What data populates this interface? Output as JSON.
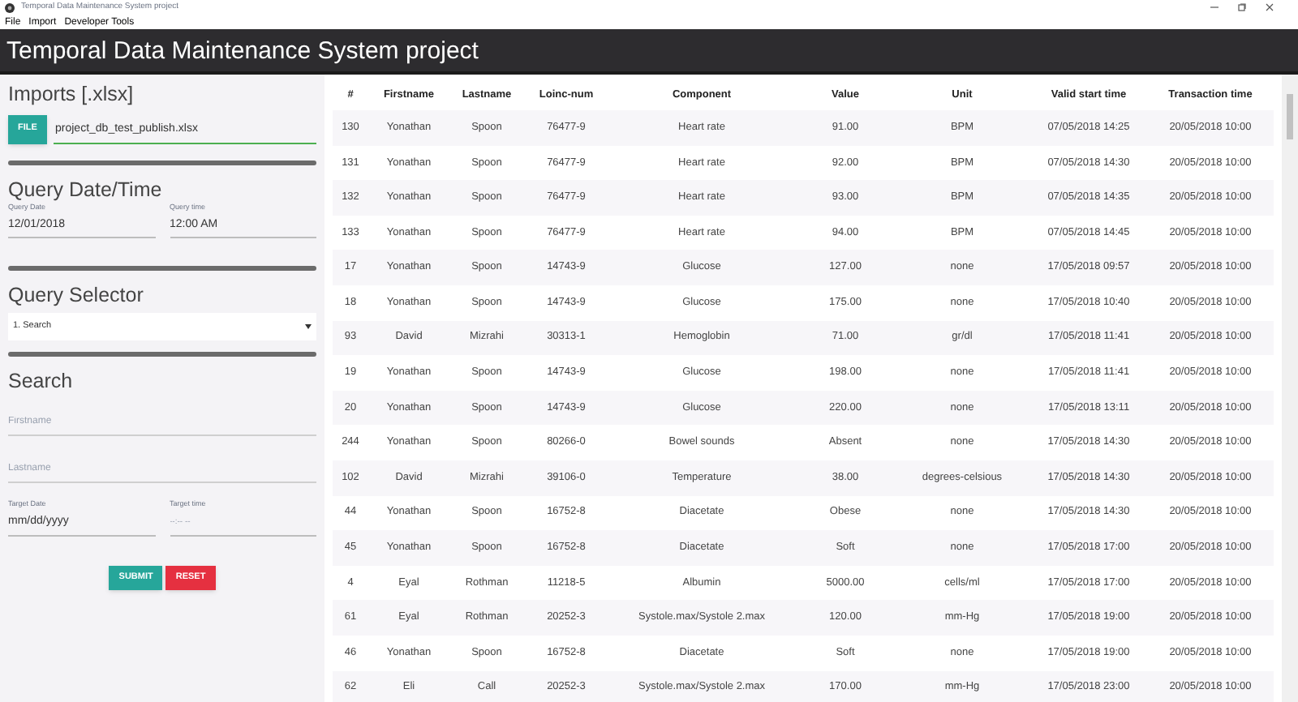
{
  "window": {
    "title": "Temporal Data Maintenance System project"
  },
  "menu": [
    "File",
    "Import",
    "Developer Tools"
  ],
  "header": {
    "title": "Temporal Data Maintenance System project"
  },
  "imports": {
    "title": "Imports [.xlsx]",
    "button": "FILE",
    "value": "project_db_test_publish.xlsx"
  },
  "query_datetime": {
    "title": "Query Date/Time",
    "fields": [
      {
        "label": "Query Date",
        "value": "12/01/2018"
      },
      {
        "label": "Query time",
        "value": "12:00 AM"
      }
    ]
  },
  "query_selector": {
    "title": "Query Selector",
    "value": "1. Search"
  },
  "search": {
    "title": "Search",
    "fields": [
      {
        "placeholder": "Firstname"
      },
      {
        "placeholder": "Lastname"
      }
    ],
    "targets": [
      {
        "label": "Target Date",
        "placeholder": "mm/dd/yyyy"
      },
      {
        "label": "Target time",
        "placeholder": "--:-- --"
      }
    ],
    "buttons": [
      {
        "label": "SUBMIT",
        "kind": "submit"
      },
      {
        "label": "RESET",
        "kind": "reset"
      }
    ]
  },
  "table": {
    "columns": [
      "#",
      "Firstname",
      "Lastname",
      "Loinc-num",
      "Component",
      "Value",
      "Unit",
      "Valid start time",
      "Transaction time"
    ],
    "rows": [
      [
        "130",
        "Yonathan",
        "Spoon",
        "76477-9",
        "Heart rate",
        "91.00",
        "BPM",
        "07/05/2018 14:25",
        "20/05/2018 10:00"
      ],
      [
        "131",
        "Yonathan",
        "Spoon",
        "76477-9",
        "Heart rate",
        "92.00",
        "BPM",
        "07/05/2018 14:30",
        "20/05/2018 10:00"
      ],
      [
        "132",
        "Yonathan",
        "Spoon",
        "76477-9",
        "Heart rate",
        "93.00",
        "BPM",
        "07/05/2018 14:35",
        "20/05/2018 10:00"
      ],
      [
        "133",
        "Yonathan",
        "Spoon",
        "76477-9",
        "Heart rate",
        "94.00",
        "BPM",
        "07/05/2018 14:45",
        "20/05/2018 10:00"
      ],
      [
        "17",
        "Yonathan",
        "Spoon",
        "14743-9",
        "Glucose",
        "127.00",
        "none",
        "17/05/2018 09:57",
        "20/05/2018 10:00"
      ],
      [
        "18",
        "Yonathan",
        "Spoon",
        "14743-9",
        "Glucose",
        "175.00",
        "none",
        "17/05/2018 10:40",
        "20/05/2018 10:00"
      ],
      [
        "93",
        "David",
        "Mizrahi",
        "30313-1",
        "Hemoglobin",
        "71.00",
        "gr/dl",
        "17/05/2018 11:41",
        "20/05/2018 10:00"
      ],
      [
        "19",
        "Yonathan",
        "Spoon",
        "14743-9",
        "Glucose",
        "198.00",
        "none",
        "17/05/2018 11:41",
        "20/05/2018 10:00"
      ],
      [
        "20",
        "Yonathan",
        "Spoon",
        "14743-9",
        "Glucose",
        "220.00",
        "none",
        "17/05/2018 13:11",
        "20/05/2018 10:00"
      ],
      [
        "244",
        "Yonathan",
        "Spoon",
        "80266-0",
        "Bowel sounds",
        "Absent",
        "none",
        "17/05/2018 14:30",
        "20/05/2018 10:00"
      ],
      [
        "102",
        "David",
        "Mizrahi",
        "39106-0",
        "Temperature",
        "38.00",
        "degrees-celsious",
        "17/05/2018 14:30",
        "20/05/2018 10:00"
      ],
      [
        "44",
        "Yonathan",
        "Spoon",
        "16752-8",
        "Diacetate",
        "Obese",
        "none",
        "17/05/2018 14:30",
        "20/05/2018 10:00"
      ],
      [
        "45",
        "Yonathan",
        "Spoon",
        "16752-8",
        "Diacetate",
        "Soft",
        "none",
        "17/05/2018 17:00",
        "20/05/2018 10:00"
      ],
      [
        "4",
        "Eyal",
        "Rothman",
        "11218-5",
        "Albumin",
        "5000.00",
        "cells/ml",
        "17/05/2018 17:00",
        "20/05/2018 10:00"
      ],
      [
        "61",
        "Eyal",
        "Rothman",
        "20252-3",
        "Systole.max/Systole 2.max",
        "120.00",
        "mm-Hg",
        "17/05/2018 19:00",
        "20/05/2018 10:00"
      ],
      [
        "46",
        "Yonathan",
        "Spoon",
        "16752-8",
        "Diacetate",
        "Soft",
        "none",
        "17/05/2018 19:00",
        "20/05/2018 10:00"
      ],
      [
        "62",
        "Eli",
        "Call",
        "20252-3",
        "Systole.max/Systole 2.max",
        "170.00",
        "mm-Hg",
        "17/05/2018 23:00",
        "20/05/2018 10:00"
      ]
    ]
  }
}
